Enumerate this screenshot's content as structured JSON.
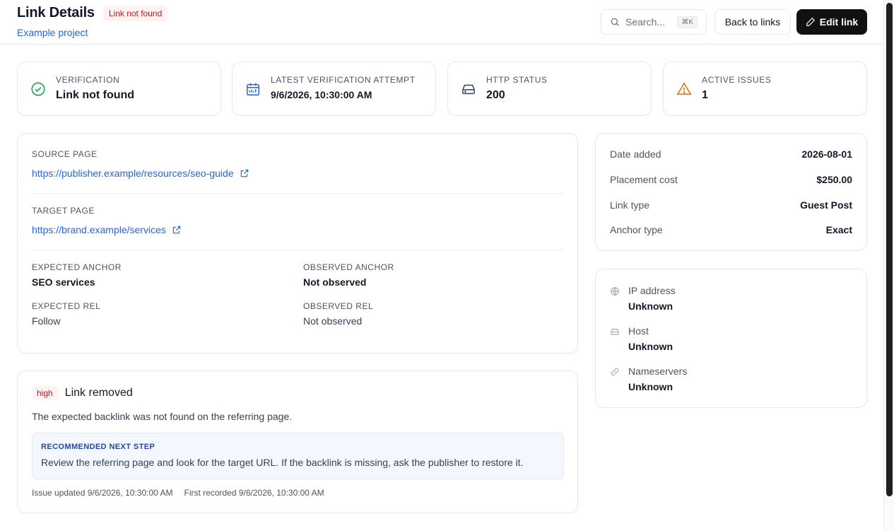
{
  "header": {
    "title": "Link Details",
    "status_badge": "Link not found",
    "project": "Example project",
    "search_placeholder": "Search...",
    "search_shortcut": "⌘K",
    "back_label": "Back to links",
    "edit_label": "Edit link"
  },
  "stats": [
    {
      "label": "VERIFICATION",
      "value": "Link not found",
      "icon": "check-circle-icon",
      "color": "#16a34a"
    },
    {
      "label": "LATEST VERIFICATION ATTEMPT",
      "value": "9/6/2026, 10:30:00 AM",
      "icon": "calendar-icon",
      "color": "#2563eb"
    },
    {
      "label": "HTTP STATUS",
      "value": "200",
      "icon": "hard-drive-icon",
      "color": "#374151"
    },
    {
      "label": "ACTIVE ISSUES",
      "value": "1",
      "icon": "warning-triangle-icon",
      "color": "#d97706"
    }
  ],
  "details": {
    "source_label": "SOURCE PAGE",
    "source_url": "https://publisher.example/resources/seo-guide",
    "target_label": "TARGET PAGE",
    "target_url": "https://brand.example/services",
    "expected_anchor_label": "EXPECTED ANCHOR",
    "expected_anchor": "SEO services",
    "observed_anchor_label": "OBSERVED ANCHOR",
    "observed_anchor": "Not observed",
    "expected_rel_label": "EXPECTED REL",
    "expected_rel": "Follow",
    "observed_rel_label": "OBSERVED REL",
    "observed_rel": "Not observed"
  },
  "meta": [
    {
      "key": "Date added",
      "value": "2026-08-01"
    },
    {
      "key": "Placement cost",
      "value": "$250.00"
    },
    {
      "key": "Link type",
      "value": "Guest Post"
    },
    {
      "key": "Anchor type",
      "value": "Exact"
    }
  ],
  "hosting": [
    {
      "label": "IP address",
      "value": "Unknown",
      "icon": "globe-icon"
    },
    {
      "label": "Host",
      "value": "Unknown",
      "icon": "server-icon"
    },
    {
      "label": "Nameservers",
      "value": "Unknown",
      "icon": "link-icon"
    }
  ],
  "issue": {
    "severity": "high",
    "title": "Link removed",
    "description": "The expected backlink was not found on the referring page.",
    "rec_label": "RECOMMENDED NEXT STEP",
    "rec_text": "Review the referring page and look for the target URL. If the backlink is missing, ask the publisher to restore it.",
    "updated": "Issue updated 9/6/2026, 10:30:00 AM",
    "recorded": "First recorded 9/6/2026, 10:30:00 AM"
  }
}
